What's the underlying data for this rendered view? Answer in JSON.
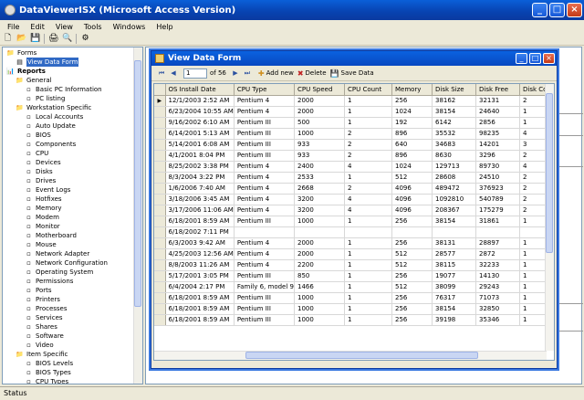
{
  "app": {
    "title": "DataViewerISX (Microsoft Access Version)"
  },
  "menu": [
    "File",
    "Edit",
    "View",
    "Tools",
    "Windows",
    "Help"
  ],
  "tree": [
    {
      "label": "Forms",
      "icon": "folder-icon",
      "level": 0
    },
    {
      "label": "View Data Form",
      "icon": "form-icon",
      "level": 1,
      "selected": true
    },
    {
      "label": "Reports",
      "icon": "report-icon",
      "level": 0,
      "bold": true
    },
    {
      "label": "General",
      "icon": "folder-icon",
      "level": 1
    },
    {
      "label": "Basic PC Information",
      "icon": "doc-icon",
      "level": 2
    },
    {
      "label": "PC listing",
      "icon": "doc-icon",
      "level": 2
    },
    {
      "label": "Workstation Specific",
      "icon": "folder-icon",
      "level": 1
    },
    {
      "label": "Local Accounts",
      "icon": "doc-icon",
      "level": 2
    },
    {
      "label": "Auto Update",
      "icon": "doc-icon",
      "level": 2
    },
    {
      "label": "BIOS",
      "icon": "doc-icon",
      "level": 2
    },
    {
      "label": "Components",
      "icon": "doc-icon",
      "level": 2
    },
    {
      "label": "CPU",
      "icon": "doc-icon",
      "level": 2
    },
    {
      "label": "Devices",
      "icon": "doc-icon",
      "level": 2
    },
    {
      "label": "Disks",
      "icon": "doc-icon",
      "level": 2
    },
    {
      "label": "Drives",
      "icon": "doc-icon",
      "level": 2
    },
    {
      "label": "Event Logs",
      "icon": "doc-icon",
      "level": 2
    },
    {
      "label": "Hotfixes",
      "icon": "doc-icon",
      "level": 2
    },
    {
      "label": "Memory",
      "icon": "doc-icon",
      "level": 2
    },
    {
      "label": "Modem",
      "icon": "doc-icon",
      "level": 2
    },
    {
      "label": "Monitor",
      "icon": "doc-icon",
      "level": 2
    },
    {
      "label": "Motherboard",
      "icon": "doc-icon",
      "level": 2
    },
    {
      "label": "Mouse",
      "icon": "doc-icon",
      "level": 2
    },
    {
      "label": "Network Adapter",
      "icon": "doc-icon",
      "level": 2
    },
    {
      "label": "Network Configuration",
      "icon": "doc-icon",
      "level": 2
    },
    {
      "label": "Operating System",
      "icon": "doc-icon",
      "level": 2
    },
    {
      "label": "Permissions",
      "icon": "doc-icon",
      "level": 2
    },
    {
      "label": "Ports",
      "icon": "doc-icon",
      "level": 2
    },
    {
      "label": "Printers",
      "icon": "doc-icon",
      "level": 2
    },
    {
      "label": "Processes",
      "icon": "doc-icon",
      "level": 2
    },
    {
      "label": "Services",
      "icon": "doc-icon",
      "level": 2
    },
    {
      "label": "Shares",
      "icon": "doc-icon",
      "level": 2
    },
    {
      "label": "Software",
      "icon": "doc-icon",
      "level": 2
    },
    {
      "label": "Video",
      "icon": "doc-icon",
      "level": 2
    },
    {
      "label": "Item Specific",
      "icon": "folder-icon",
      "level": 1
    },
    {
      "label": "BIOS Levels",
      "icon": "doc-icon",
      "level": 2
    },
    {
      "label": "BIOS Types",
      "icon": "doc-icon",
      "level": 2
    },
    {
      "label": "CPU Types",
      "icon": "doc-icon",
      "level": 2
    }
  ],
  "form": {
    "title": "View Data Form",
    "nav": {
      "position": "1",
      "of_label": "of 56"
    },
    "actions": {
      "add": "Add new",
      "delete": "Delete",
      "save": "Save Data"
    },
    "columns": [
      "OS Install Date",
      "CPU Type",
      "CPU Speed",
      "CPU Count",
      "Memory",
      "Disk Size",
      "Disk Free",
      "Disk Cou"
    ],
    "rows": [
      [
        "12/1/2003 2:52 AM",
        "Pentium 4",
        "2000",
        "1",
        "256",
        "38162",
        "32131",
        "2"
      ],
      [
        "6/23/2004 10:55 AM",
        "Pentium 4",
        "2000",
        "1",
        "1024",
        "38154",
        "24640",
        "1"
      ],
      [
        "9/16/2002 6:10 AM",
        "Pentium III",
        "500",
        "1",
        "192",
        "6142",
        "2856",
        "1"
      ],
      [
        "6/14/2001 5:13 AM",
        "Pentium III",
        "1000",
        "2",
        "896",
        "35532",
        "98235",
        "4"
      ],
      [
        "5/14/2001 6:08 AM",
        "Pentium III",
        "933",
        "2",
        "640",
        "34683",
        "14201",
        "3"
      ],
      [
        "4/1/2001 8:04 PM",
        "Pentium III",
        "933",
        "2",
        "896",
        "8630",
        "3296",
        "2"
      ],
      [
        "8/25/2002 3:38 PM",
        "Pentium 4",
        "2400",
        "4",
        "1024",
        "129713",
        "89730",
        "4"
      ],
      [
        "8/3/2004 3:22 PM",
        "Pentium 4",
        "2533",
        "1",
        "512",
        "28608",
        "24510",
        "2"
      ],
      [
        "1/6/2006 7:40 AM",
        "Pentium 4",
        "2668",
        "2",
        "4096",
        "489472",
        "376923",
        "2"
      ],
      [
        "3/18/2006 3:45 AM",
        "Pentium 4",
        "3200",
        "4",
        "4096",
        "1092810",
        "540789",
        "2"
      ],
      [
        "3/17/2006 11:06 AM",
        "Pentium 4",
        "3200",
        "4",
        "4096",
        "208367",
        "175279",
        "2"
      ],
      [
        "6/18/2001 8:59 AM",
        "Pentium III",
        "1000",
        "1",
        "256",
        "38154",
        "31861",
        "1"
      ],
      [
        "6/18/2002 7:11 PM",
        "",
        "",
        "",
        "",
        "",
        "",
        ""
      ],
      [
        "6/3/2003 9:42 AM",
        "Pentium 4",
        "2000",
        "1",
        "256",
        "38131",
        "28897",
        "1"
      ],
      [
        "4/25/2003 12:56 AM",
        "Pentium 4",
        "2000",
        "1",
        "512",
        "28577",
        "2872",
        "1"
      ],
      [
        "8/8/2003 11:26 AM",
        "Pentium 4",
        "2200",
        "1",
        "512",
        "38115",
        "32233",
        "1"
      ],
      [
        "5/17/2001 3:05 PM",
        "Pentium III",
        "850",
        "1",
        "256",
        "19077",
        "14130",
        "1"
      ],
      [
        "6/4/2004 2:17 PM",
        "Family 6, model 9",
        "1466",
        "1",
        "512",
        "38099",
        "29243",
        "1"
      ],
      [
        "6/18/2001 8:59 AM",
        "Pentium III",
        "1000",
        "1",
        "256",
        "76317",
        "71073",
        "1"
      ],
      [
        "6/18/2001 8:59 AM",
        "Pentium III",
        "1000",
        "1",
        "256",
        "38154",
        "32850",
        "1"
      ],
      [
        "6/18/2001 8:59 AM",
        "Pentium III",
        "1000",
        "1",
        "256",
        "39198",
        "35346",
        "1"
      ]
    ]
  },
  "status": "Status"
}
